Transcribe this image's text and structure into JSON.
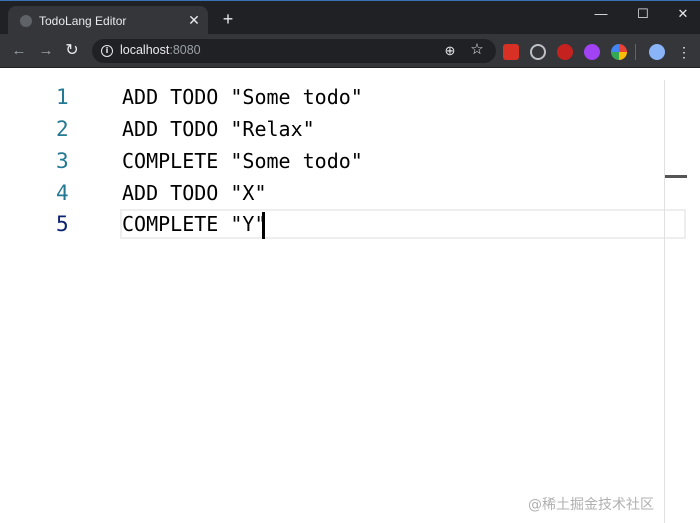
{
  "browser": {
    "tab_title": "TodoLang Editor",
    "tab_close_icon": "close-icon",
    "new_tab_icon": "plus-icon",
    "url_host": "localhost",
    "url_port": ":8080",
    "window_controls": {
      "minimize": "—",
      "maximize": "☐",
      "close": "✕"
    }
  },
  "editor": {
    "lines": [
      {
        "number": "1",
        "code": "ADD TODO \"Some todo\""
      },
      {
        "number": "2",
        "code": "ADD TODO \"Relax\""
      },
      {
        "number": "3",
        "code": "COMPLETE \"Some todo\""
      },
      {
        "number": "4",
        "code": "ADD TODO \"X\""
      },
      {
        "number": "5",
        "code": "COMPLETE \"Y\""
      }
    ],
    "active_line": 5
  },
  "watermark": "@稀土掘金技术社区",
  "colors": {
    "line_number": "#237893",
    "active_line_number": "#0b216f",
    "chrome_dark": "#202124",
    "chrome_toolbar": "#35363a"
  }
}
